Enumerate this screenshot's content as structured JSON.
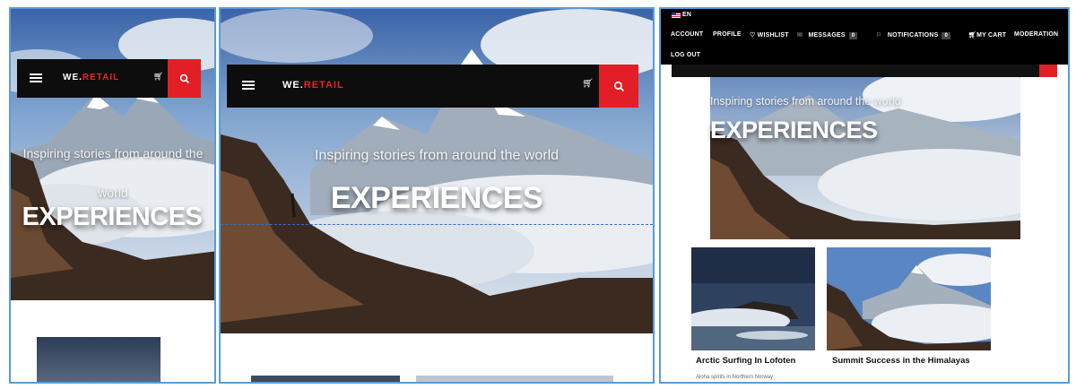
{
  "brand": {
    "prefix": "WE.",
    "suffix": "RETAIL",
    "accent": "#e21f26"
  },
  "hero": {
    "tagline": "Inspiring stories from around the world",
    "tagline_wrapped_line1": "Inspiring stories from around the",
    "tagline_wrapped_line2": "world",
    "headline": "EXPERIENCES"
  },
  "icons": {
    "menu": "hamburger-icon",
    "cart": "cart-icon",
    "search": "search-icon"
  },
  "account_bar": {
    "language": "EN",
    "account": "ACCOUNT",
    "profile": "PROFILE",
    "wishlist": "WISHLIST",
    "messages": "MESSAGES",
    "messages_count": "0",
    "notifications": "NOTIFICATIONS",
    "notifications_count": "0",
    "my_cart": "MY CART",
    "moderation": "MODERATION",
    "log_out": "LOG OUT"
  },
  "cards": [
    {
      "title": "Arctic Surfing In Lofoten",
      "subtitle": "Aloha spirits in Northern Norway"
    },
    {
      "title": "Summit Success in the Himalayas",
      "subtitle": ""
    }
  ],
  "colors": {
    "frame_border": "#5b9bd5",
    "dashed_guide": "#2e6fc9",
    "nav_bg": "#0d0d0d"
  }
}
